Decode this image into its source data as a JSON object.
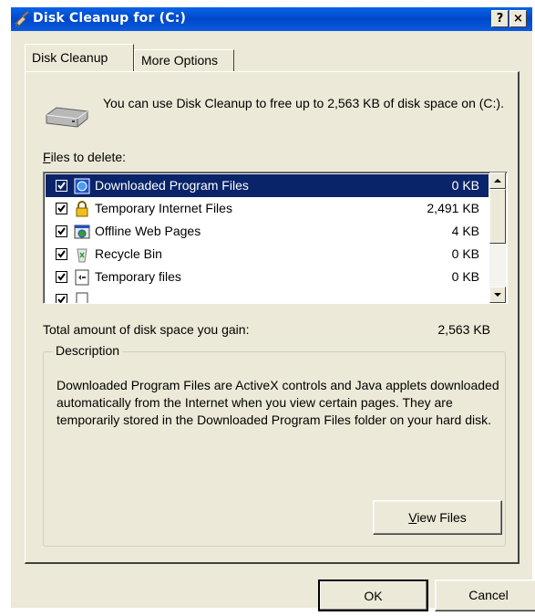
{
  "window": {
    "title": "Disk Cleanup for  (C:)",
    "help_button": "?",
    "close_button": "×"
  },
  "tabs": [
    {
      "label": "Disk Cleanup",
      "active": true
    },
    {
      "label": "More Options",
      "active": false
    }
  ],
  "intro_text": "You can use Disk Cleanup to free up to 2,563 KB of disk space on  (C:).",
  "files_to_delete": {
    "label_accel": "F",
    "label_rest": "iles to delete:",
    "items": [
      {
        "name": "Downloaded Program Files",
        "size": "0 KB",
        "checked": true,
        "selected": true,
        "icon": "downloaded-program-files-icon"
      },
      {
        "name": "Temporary Internet Files",
        "size": "2,491 KB",
        "checked": true,
        "selected": false,
        "icon": "lock-icon"
      },
      {
        "name": "Offline Web Pages",
        "size": "4 KB",
        "checked": true,
        "selected": false,
        "icon": "offline-web-pages-icon"
      },
      {
        "name": "Recycle Bin",
        "size": "0 KB",
        "checked": true,
        "selected": false,
        "icon": "recycle-bin-icon"
      },
      {
        "name": "Temporary files",
        "size": "0 KB",
        "checked": true,
        "selected": false,
        "icon": "temporary-files-icon"
      }
    ]
  },
  "total": {
    "label": "Total amount of disk space you gain:",
    "value": "2,563 KB"
  },
  "description": {
    "title": "Description",
    "text": "Downloaded Program Files are ActiveX controls and Java applets downloaded automatically from the Internet when you view certain pages. They are temporarily stored in the Downloaded Program Files folder on your hard disk."
  },
  "buttons": {
    "view_files_accel": "V",
    "view_files_rest": "iew Files",
    "ok": "OK",
    "cancel": "Cancel"
  }
}
